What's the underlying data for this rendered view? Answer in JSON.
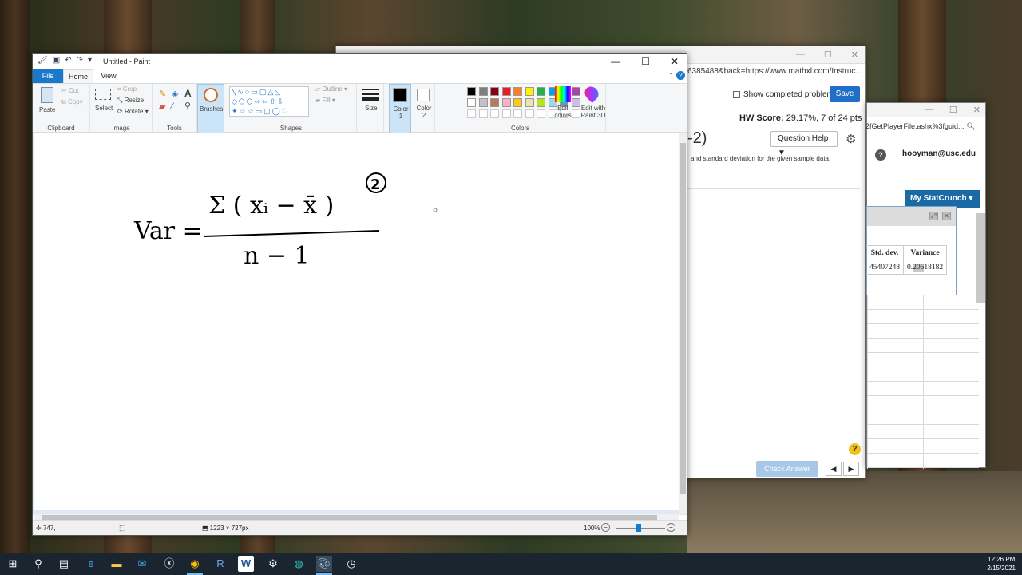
{
  "paint": {
    "title": "Untitled - Paint",
    "tabs": [
      "File",
      "Home",
      "View"
    ],
    "clipboard": {
      "paste": "Paste",
      "cut": "Cut",
      "copy": "Copy",
      "label": "Clipboard"
    },
    "image": {
      "select": "Select",
      "crop": "Crop",
      "resize": "Resize",
      "rotate": "Rotate",
      "label": "Image"
    },
    "tools": {
      "label": "Tools"
    },
    "brushes": {
      "label": "Brushes"
    },
    "shapes": {
      "outline": "Outline",
      "fill": "Fill",
      "label": "Shapes"
    },
    "size": {
      "label": "Size"
    },
    "color1": {
      "label": "Color",
      "num": "1"
    },
    "color2": {
      "label": "Color",
      "num": "2"
    },
    "colors": {
      "label": "Colors",
      "edit": "Edit colors",
      "paint3d": "Edit with Paint 3D",
      "palette_row1": [
        "#000000",
        "#7f7f7f",
        "#880015",
        "#ed1c24",
        "#ff7f27",
        "#fff200",
        "#22b14c",
        "#00a2e8",
        "#3f48cc",
        "#a349a4"
      ],
      "palette_row2": [
        "#ffffff",
        "#c3c3c3",
        "#b97a57",
        "#ffaec9",
        "#ffc90e",
        "#efe4b0",
        "#b5e61d",
        "#99d9ea",
        "#7092be",
        "#c8bfe7"
      ]
    },
    "status": {
      "cursor_pos": "747,",
      "canvas_size": "1223 × 727px",
      "zoom": "100%"
    }
  },
  "drawing": {
    "lhs": "Var =",
    "numerator": "Σ ( xᵢ − x̄ )",
    "exponent": "2",
    "denominator": "n − 1"
  },
  "mathxl": {
    "url": "6385488&back=https://www.mathxl.com/Instruc...",
    "points_fragment": "-2)",
    "show_completed": "Show completed problem",
    "save": "Save",
    "hw_score_label": "HW Score:",
    "hw_score_value": "29.17%, 7 of 24 pts",
    "question_help": "Question Help",
    "question_text": "and standard deviation for the given sample data.",
    "check_answer": "Check Answer"
  },
  "statcrunch": {
    "url": "2fGetPlayerFile.ashx%3fguid...",
    "user": "hooyman@usc.edu",
    "menu": "My StatCrunch",
    "table": {
      "headers": [
        "Std. dev.",
        "Variance"
      ],
      "row": [
        "45407248",
        "0.",
        "206",
        "18182"
      ]
    }
  },
  "clock": {
    "time": "12:26 PM",
    "date": "2/15/2021"
  }
}
